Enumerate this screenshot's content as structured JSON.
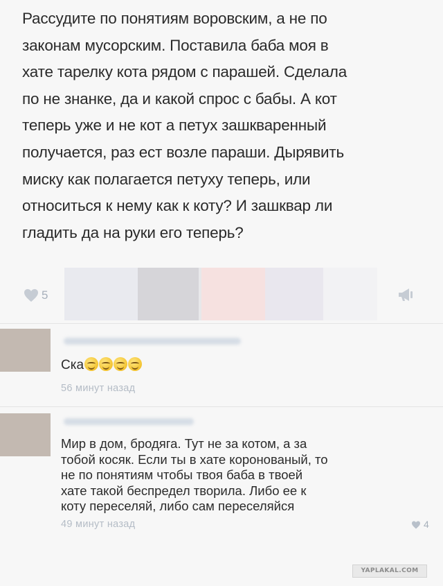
{
  "post": {
    "lines": [
      "Рассудите по понятиям воровским, а не по",
      "законам мусорским. Поставила баба моя в",
      "хате тарелку кота рядом с парашей. Сделала",
      "по не знанке, да и какой спрос с бабы. А кот",
      "теперь уже и не кот а петух зашкваренный",
      "получается, раз ест возле параши. Дырявить",
      "миску как полагается петуху теперь, или",
      "относиться к нему как к коту? И зашквар ли",
      "гладить да на руки его теперь?"
    ],
    "likes": "5",
    "like_icon": "heart-icon",
    "share_icon": "megaphone-icon",
    "blur_colors": [
      "#e9eaef",
      "#d5d4d8",
      "#f6e1e0",
      "#e9e7ee"
    ]
  },
  "comments": [
    {
      "text_prefix": "Ска",
      "emoji": [
        "grinning-emoji",
        "grinning-emoji",
        "grinning-emoji",
        "grinning-emoji"
      ],
      "time": "56 минут назад"
    },
    {
      "lines": [
        "Мир в дом, бродяга. Тут не за котом, а за",
        "тобой косяк. Если ты в хате коронованый, то",
        "не по понятиям чтобы твоя баба в твоей",
        "хате такой беспредел творила. Либо ее к",
        "коту переселяй, либо сам переселяйся"
      ],
      "time": "49 минут назад",
      "likes": "4"
    }
  ],
  "watermark": "YAPLAKAL.COM",
  "colors": {
    "text": "#2a2a2a",
    "muted": "#b4bcc6",
    "avatar": "#c3b9b1"
  }
}
